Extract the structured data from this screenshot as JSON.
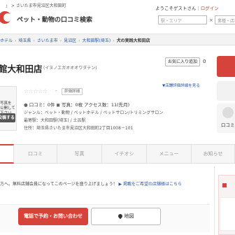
{
  "header": {
    "crumb_top": "」 > さいたま市見沼区大和田町",
    "site_title": "ペット・動物の口コミ検索",
    "welcome": "ようこそゲストさん",
    "login": "ログイン",
    "search_station_placeholder": "駅・エリア",
    "search_category_placeholder": "業種・店名"
  },
  "breadcrumbs": [
    {
      "label": "ホテル"
    },
    {
      "label": "埼玉県"
    },
    {
      "label": "さいたま市"
    },
    {
      "label": "見沼区"
    },
    {
      "label": "大和田駅(埼玉)"
    }
  ],
  "breadcrumb_current": "犬の実践大和田店",
  "shop": {
    "name": "館大和田店",
    "kana": "(イヌノエガオオオワダテン)",
    "favorite_label": "お気に入り追加",
    "favorite_count": "0",
    "photo_text": "写真を\n公開して\n下さい",
    "photo_button": "投稿する",
    "stars": "☆☆☆☆☆",
    "rating_dash": "-",
    "rating_label": "評価詳細",
    "rating_help": "▼店舗評価詳細を見る",
    "kuchikomi_side_label": "口コミ"
  },
  "stats": {
    "kuchikomi": "口コミ：0件",
    "photos": "写真：0枚",
    "access": "アクセス数：11(先月)"
  },
  "info": [
    "ジャンル：ペット・動物 / ペットホテル / ペットサロン/トリミングサロン",
    "最寄駅：大和田駅(埼玉) / 土呂駅",
    "住所：埼玉県さいたま市見沼区大和田町2丁目1008－101"
  ],
  "tabs": [
    {
      "label": ""
    },
    {
      "label": "口コミ"
    },
    {
      "label": "写真"
    },
    {
      "label": "イチオシ"
    },
    {
      "label": "メニュー"
    },
    {
      "label": "お知らせ"
    }
  ],
  "notice": {
    "text": "方へ。無料店舗会員になってこのページを盛り上げましょう！",
    "link": "▶ 掲載をご希望の店舗様はこちら"
  },
  "cta": {
    "tel": "電話で予約・お問い合わせ",
    "map": "地図"
  },
  "colors": {
    "accent": "#d6433a",
    "link": "#2a55a5"
  }
}
